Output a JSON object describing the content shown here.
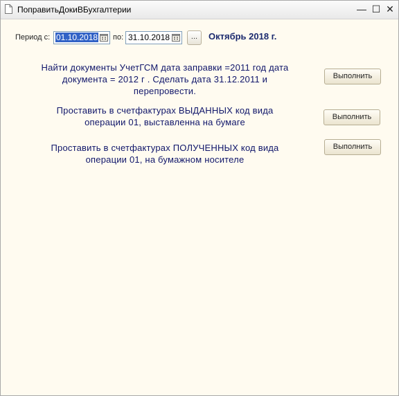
{
  "window": {
    "title": "ПоправитьДокиВБухгалтерии",
    "minimize_glyph": "—",
    "maximize_glyph": "☐",
    "close_glyph": "✕"
  },
  "period": {
    "label": "Период с:",
    "from_value": "01.10.2018",
    "to_label": "по:",
    "to_value": "31.10.2018",
    "dots_label": "...",
    "display": "Октябрь 2018 г."
  },
  "tasks": [
    {
      "lines": [
        "Найти документы УчетГСМ дата заправки =2011 год дата",
        "документа = 2012 г . Сделать дата 31.12.2011 и",
        "перепровести."
      ],
      "button_label": "Выполнить"
    },
    {
      "lines": [
        "Проставить в счетфактурах ВЫДАННЫХ код вида",
        "операции 01, выставленна на бумаге"
      ],
      "button_label": "Выполнить"
    },
    {
      "lines": [
        "Проставить в счетфактурах ПОЛУЧЕННЫХ код вида",
        "операции 01, на бумажном носителе"
      ],
      "button_label": "Выполнить"
    }
  ],
  "colors": {
    "background": "#fffbf0",
    "text_accent": "#10166a",
    "selection": "#3162c6"
  }
}
